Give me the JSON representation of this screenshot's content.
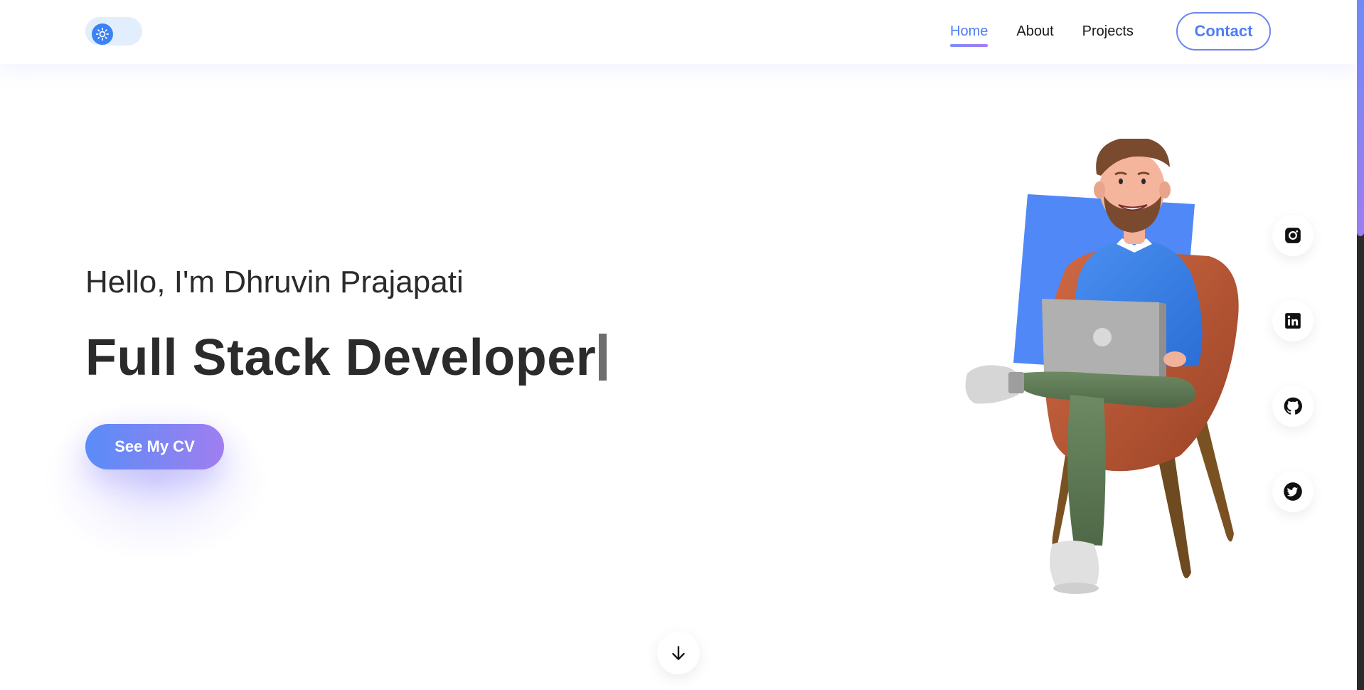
{
  "header": {
    "theme_toggle_icon": "sun-icon",
    "nav": [
      {
        "label": "Home",
        "active": true
      },
      {
        "label": "About",
        "active": false
      },
      {
        "label": "Projects",
        "active": false
      }
    ],
    "contact_label": "Contact"
  },
  "hero": {
    "greeting": "Hello, I'm Dhruvin Prajapati",
    "role": "Full Stack Developer",
    "cv_button_label": "See My CV",
    "illustration": "developer-sitting-with-laptop-illustration"
  },
  "social": [
    {
      "name": "instagram-icon"
    },
    {
      "name": "linkedin-icon"
    },
    {
      "name": "github-icon"
    },
    {
      "name": "twitter-icon"
    }
  ],
  "scroll_down_icon": "arrow-down-icon",
  "colors": {
    "accent_blue": "#4f7ef4",
    "accent_purple": "#a07ef0",
    "text_dark": "#2b2b2b",
    "illustration_square": "#5088f7"
  }
}
